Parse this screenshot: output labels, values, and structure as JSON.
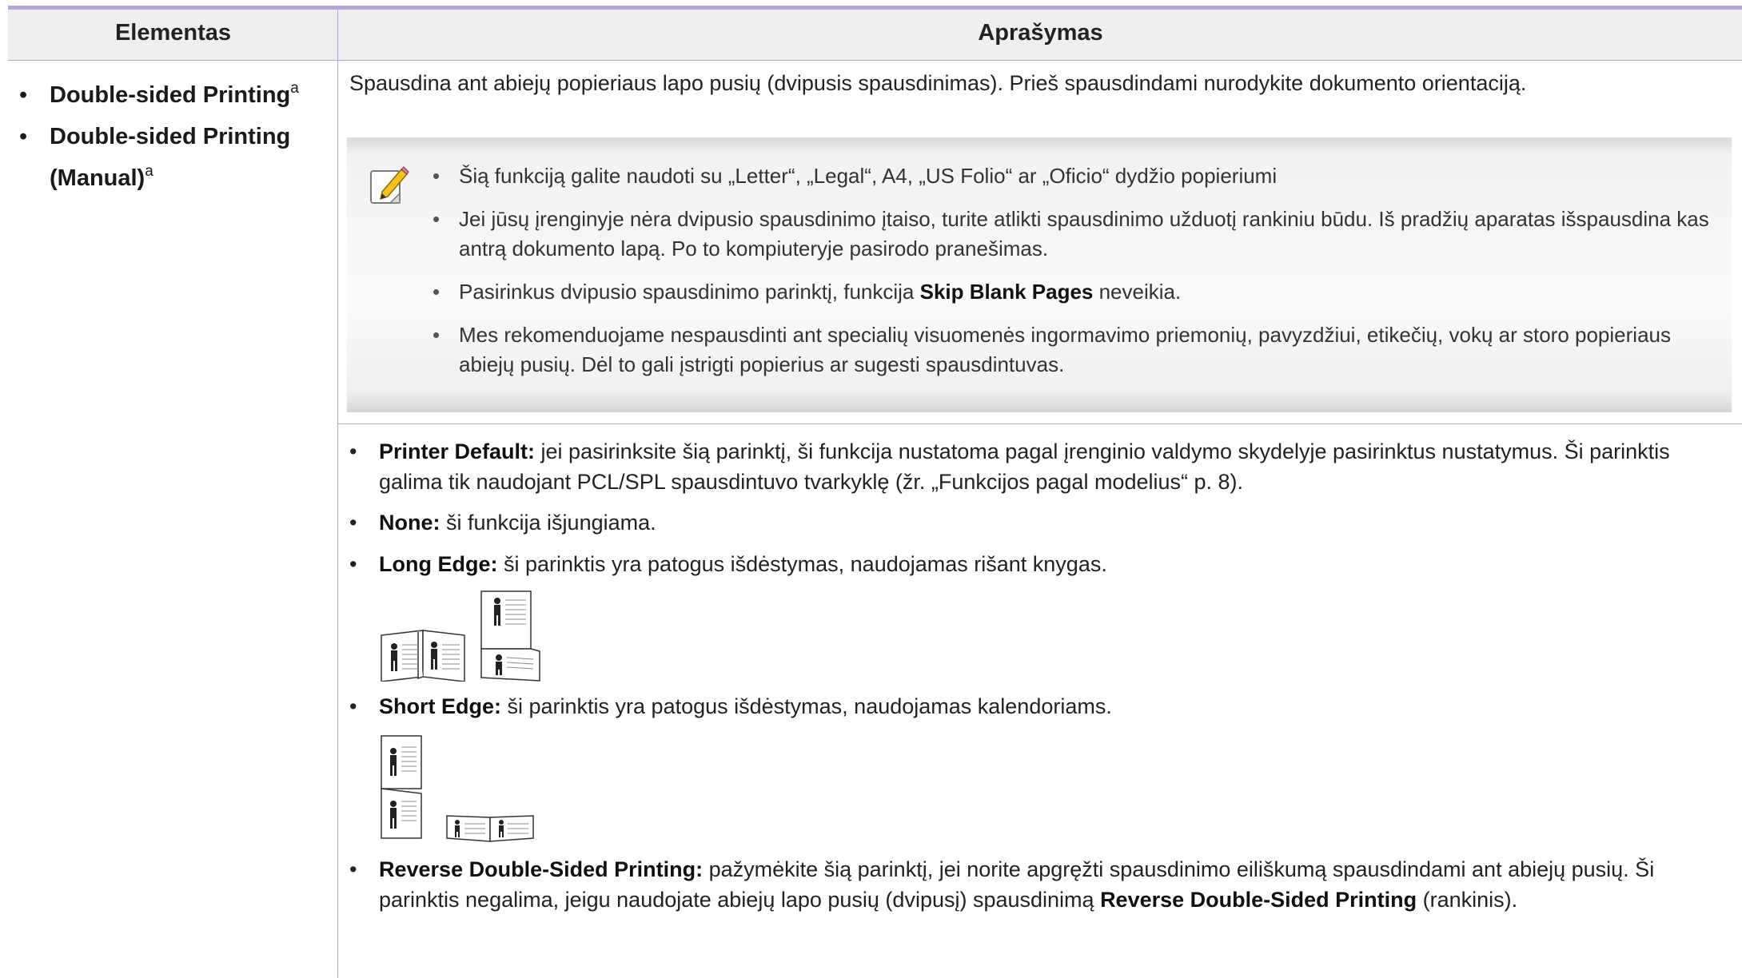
{
  "table": {
    "col1_header": "Elementas",
    "col2_header": "Aprašymas"
  },
  "left": {
    "item1": "Double-sided Printing",
    "item1_sup": "a",
    "item2": "Double-sided Printing (Manual)",
    "item2_sup": "a"
  },
  "description": "Spausdina ant abiejų popieriaus lapo pusių (dvipusis spausdinimas). Prieš spausdindami nurodykite dokumento orientaciją.",
  "note": {
    "icon": "note-pencil-icon",
    "items": [
      "Šią funkciją galite naudoti su „Letter“, „Legal“, A4, „US Folio“ ar „Oficio“ dydžio popieriumi",
      "Jei jūsų įrenginyje nėra dvipusio spausdinimo įtaiso, turite atlikti spausdinimo užduotį rankiniu būdu. Iš pradžių aparatas išspausdina kas antrą dokumento lapą. Po to kompiuteryje pasirodo pranešimas."
    ],
    "item3_pre": "Pasirinkus dvipusio spausdinimo parinktį, funkcija ",
    "item3_bold": "Skip Blank Pages",
    "item3_post": " neveikia.",
    "item4": "Mes rekomenduojame nespausdinti ant specialių visuomenės ingormavimo priemonių, pavyzdžiui, etikečių, vokų ar storo popieriaus abiejų pusių. Dėl to gali įstrigti popierius ar sugesti spausdintuvas."
  },
  "options": {
    "printer_default_label": "Printer Default:",
    "printer_default_text": " jei pasirinksite šią parinktį, ši funkcija nustatoma pagal įrenginio valdymo skydelyje pasirinktus nustatymus. Ši parinktis galima tik naudojant PCL/SPL spausdintuvo tvarkyklę (žr. „Funkcijos pagal modelius“ p. 8).",
    "none_label": "None:",
    "none_text": " ši funkcija išjungiama.",
    "long_edge_label": "Long Edge:",
    "long_edge_text": " ši parinktis yra patogus išdėstymas, naudojamas rišant knygas.",
    "short_edge_label": "Short Edge:",
    "short_edge_text": " ši parinktis yra patogus išdėstymas, naudojamas kalendoriams.",
    "reverse_label": "Reverse Double-Sided Printing:",
    "reverse_text": " pažymėkite šią parinktį, jei norite apgręžti spausdinimo eiliškumą spausdindami ant abiejų pusių. Ši parinktis negalima, jeigu naudojate abiejų lapo pusių (dvipusį) spausdinimą ",
    "reverse_bold2": "Reverse Double-Sided Printing",
    "reverse_tail": " (rankinis).",
    "long_edge_image": "long-edge-binding-illustration",
    "short_edge_image": "short-edge-binding-illustration"
  }
}
